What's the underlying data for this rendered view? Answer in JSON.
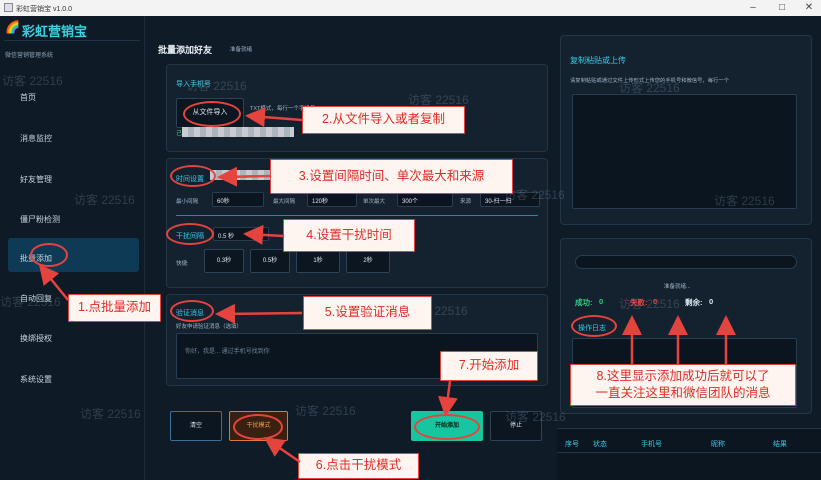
{
  "window": {
    "title": "彩虹营销宝 v1.0.0",
    "minimize": "–",
    "maximize": "□",
    "close": "✕"
  },
  "sidebar": {
    "logo": "彩虹营销宝",
    "subtitle": "微信营销管理系统",
    "items": [
      {
        "label": "首页"
      },
      {
        "label": "消息监控"
      },
      {
        "label": "好友管理"
      },
      {
        "label": "僵尸粉检测"
      },
      {
        "label": "批量添加"
      },
      {
        "label": "自动回复"
      },
      {
        "label": "换绑授权"
      },
      {
        "label": "系统设置"
      }
    ]
  },
  "main": {
    "title": "批量添加好友",
    "status": "准备就绪",
    "import": {
      "heading": "导入手机号",
      "button": "从文件导入",
      "hint": "TXT模式，每行一个手机号",
      "extra": "己"
    },
    "timing": {
      "heading": "时间设置",
      "min_label": "最小间隔",
      "min_value": "60秒",
      "max_label": "最大间隔",
      "max_value": "120秒",
      "single_label": "单次最大",
      "single_value": "300个",
      "source_label": "来源",
      "source_value": "30-扫一扫"
    },
    "interference": {
      "heading": "干扰间隔",
      "value": "0.5 秒",
      "quick_label": "快捷:",
      "quick": [
        "0.3秒",
        "0.5秒",
        "1秒",
        "2秒"
      ]
    },
    "verify": {
      "heading": "验证消息",
      "sublabel": "好友申请验证消息（选填）",
      "placeholder": "你好，我是... 通过手机号找到你"
    },
    "buttons": {
      "clear": "清空",
      "interfere": "干扰模式",
      "start": "开始添加",
      "stop": "停止"
    }
  },
  "right": {
    "paste": {
      "heading": "复制粘贴或上传",
      "hint": "请复制粘贴或通过文件上传形式上传您的手机号和微信号，每行一个"
    },
    "progress": {
      "status": "准备就绪..."
    },
    "stats": {
      "success_label": "成功:",
      "success": "0",
      "fail_label": "失败:",
      "fail": "0",
      "remain_label": "剩余:",
      "remain": "0"
    },
    "log_heading": "操作日志",
    "table": {
      "headers": [
        "序号",
        "状态",
        "手机号",
        "昵称",
        "结果"
      ]
    }
  },
  "annotations": [
    "1.点批量添加",
    "2.从文件导入或者复制",
    "3.设置间隔时间、单次最大和来源",
    "4.设置干扰时间",
    "5.设置验证消息",
    "6.点击干扰模式",
    "7.开始添加",
    "8.这里显示添加成功后就可以了一直关注这里和微信团队的消息"
  ],
  "annotation8": {
    "line1": "8.这里显示添加成功后就可以了",
    "line2": "一直关注这里和微信团队的消息"
  },
  "watermark": "访客 22516",
  "colors": {
    "accent": "#3bc9e6",
    "annotation": "#e5443e",
    "start": "#17c6a0",
    "interfere": "#e07a2a"
  }
}
